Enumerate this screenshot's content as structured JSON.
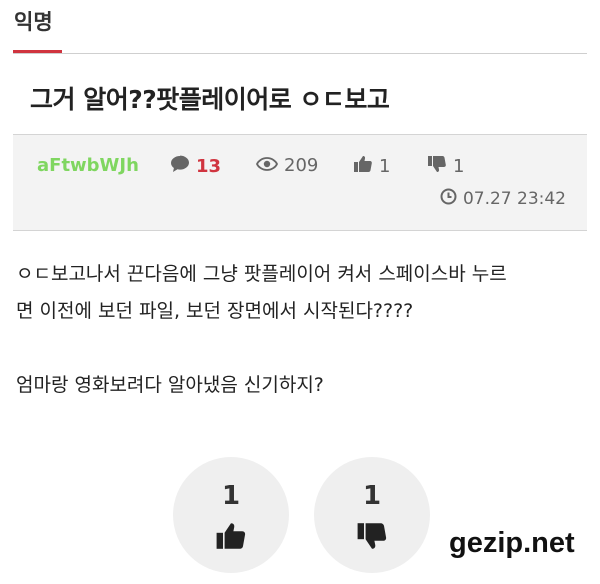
{
  "tab": {
    "label": "익명"
  },
  "post": {
    "title": "그거 알어??팟플레이어로 ㅇㄷ보고",
    "author": "aFtwbWJh",
    "comment_count": "13",
    "view_count": "209",
    "like_count": "1",
    "dislike_count": "1",
    "timestamp": "07.27 23:42",
    "body_lines": [
      "ㅇㄷ보고나서 끈다음에 그냥 팟플레이어 켜서 스페이스바 누르",
      "면 이전에 보던 파일, 보던 장면에서 시작된다????",
      "",
      "엄마랑 영화보려다 알아냈음 신기하지?"
    ]
  },
  "votes": {
    "up": "1",
    "down": "1"
  },
  "watermark": "gezip.net",
  "colors": {
    "accent": "#d0343f",
    "author": "#7fd660",
    "meta_bg": "#f3f3f3"
  },
  "icons": [
    "comment-icon",
    "eye-icon",
    "thumbs-up-icon",
    "thumbs-down-icon",
    "clock-icon"
  ]
}
